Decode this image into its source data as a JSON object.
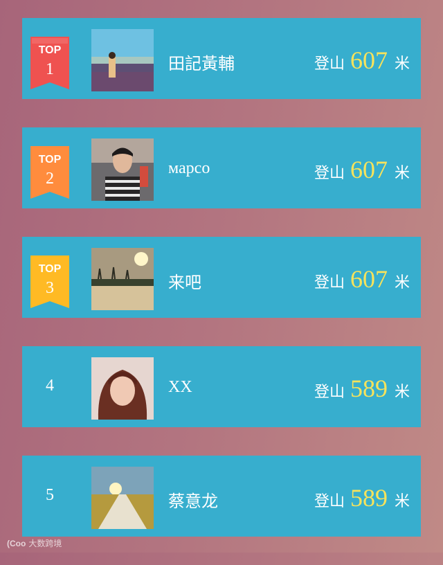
{
  "colors": {
    "row_bg": "#37aece",
    "score_accent": "#f7e35b",
    "badge_top1": "#ef5250",
    "badge_top2": "#ff8c3d",
    "badge_top3": "#ffba24"
  },
  "leaderboard": [
    {
      "rank_label": "TOP",
      "rank": "1",
      "name": "田記黃輔",
      "prefix": "登山",
      "value": "607",
      "unit": "米",
      "avatar_icon": "field-person-avatar"
    },
    {
      "rank_label": "TOP",
      "rank": "2",
      "name": "марco",
      "prefix": "登山",
      "value": "607",
      "unit": "米",
      "avatar_icon": "young-man-avatar"
    },
    {
      "rank_label": "TOP",
      "rank": "3",
      "name": "来吧",
      "prefix": "登山",
      "value": "607",
      "unit": "米",
      "avatar_icon": "sunset-landscape-avatar"
    },
    {
      "rank": "4",
      "name": "XX",
      "prefix": "登山",
      "value": "589",
      "unit": "米",
      "avatar_icon": "woman-portrait-avatar"
    },
    {
      "rank": "5",
      "name": "蔡意龙",
      "prefix": "登山",
      "value": "589",
      "unit": "米",
      "avatar_icon": "sunrise-road-avatar"
    }
  ],
  "watermark": {
    "logo": "(Coo",
    "text": "大数跨境"
  }
}
